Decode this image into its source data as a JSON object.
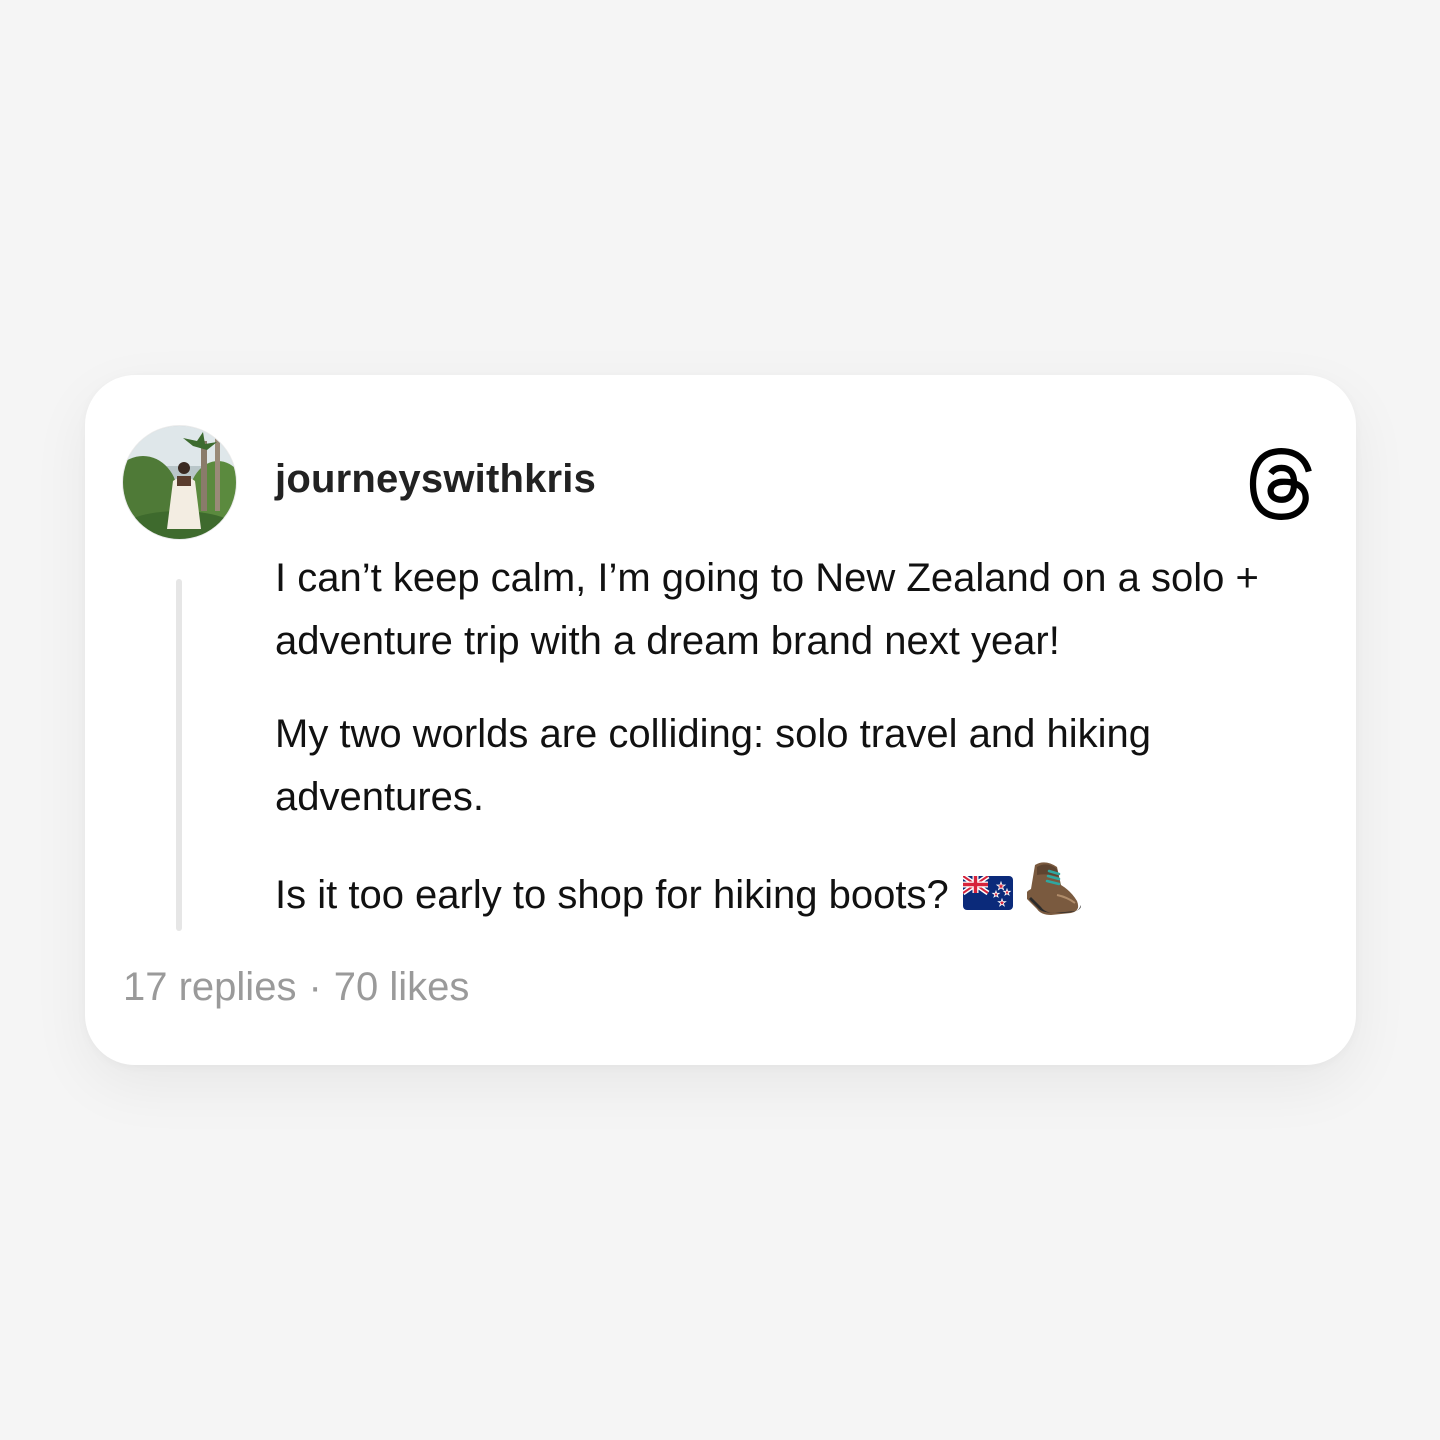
{
  "post": {
    "username": "journeyswithkris",
    "paragraphs": [
      "I can’t keep calm, I’m going to New Zealand on a solo + adventure trip with a dream brand next year!",
      "My two worlds are colliding: solo travel and hiking adventures.",
      "Is it too early to shop for hiking boots?"
    ],
    "emojis": [
      "nz-flag-emoji",
      "hiking-boot-emoji"
    ],
    "replies": "17 replies",
    "separator": "·",
    "likes": "70 likes"
  },
  "icons": {
    "brand": "threads-logo-icon"
  },
  "colors": {
    "background": "#f5f5f5",
    "card": "#ffffff",
    "text": "#111111",
    "muted": "#9a9a9a",
    "thread_line": "#e6e6e6"
  }
}
